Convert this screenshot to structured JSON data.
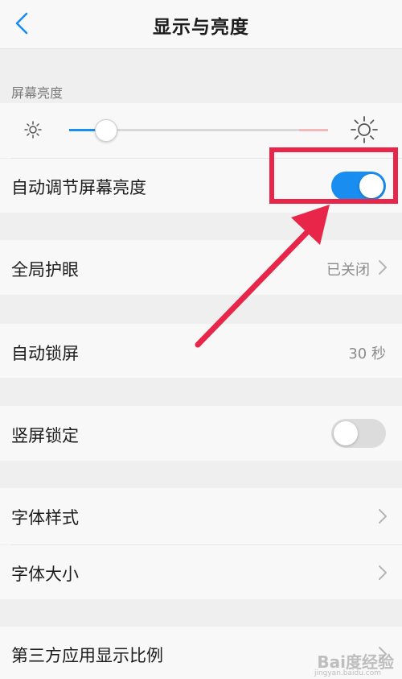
{
  "header": {
    "title": "显示与亮度",
    "back_icon": "chevron-left-icon",
    "accent_color": "#1a8df0"
  },
  "brightness": {
    "section_label": "屏幕亮度",
    "level": 0.14,
    "low_icon": "sun-small-icon",
    "high_icon": "sun-large-icon"
  },
  "auto_brightness": {
    "label": "自动调节屏幕亮度",
    "enabled": true
  },
  "eye_care": {
    "label": "全局护眼",
    "value": "已关闭"
  },
  "auto_lock": {
    "label": "自动锁屏",
    "value": "30 秒"
  },
  "portrait_lock": {
    "label": "竖屏锁定",
    "enabled": false
  },
  "font_style": {
    "label": "字体样式"
  },
  "font_size": {
    "label": "字体大小"
  },
  "third_party_ratio": {
    "label": "第三方应用显示比例"
  },
  "annotation": {
    "color": "#e8264a"
  },
  "watermark": {
    "text": "Bai度经验",
    "sub": "jingyan.baidu.com"
  }
}
